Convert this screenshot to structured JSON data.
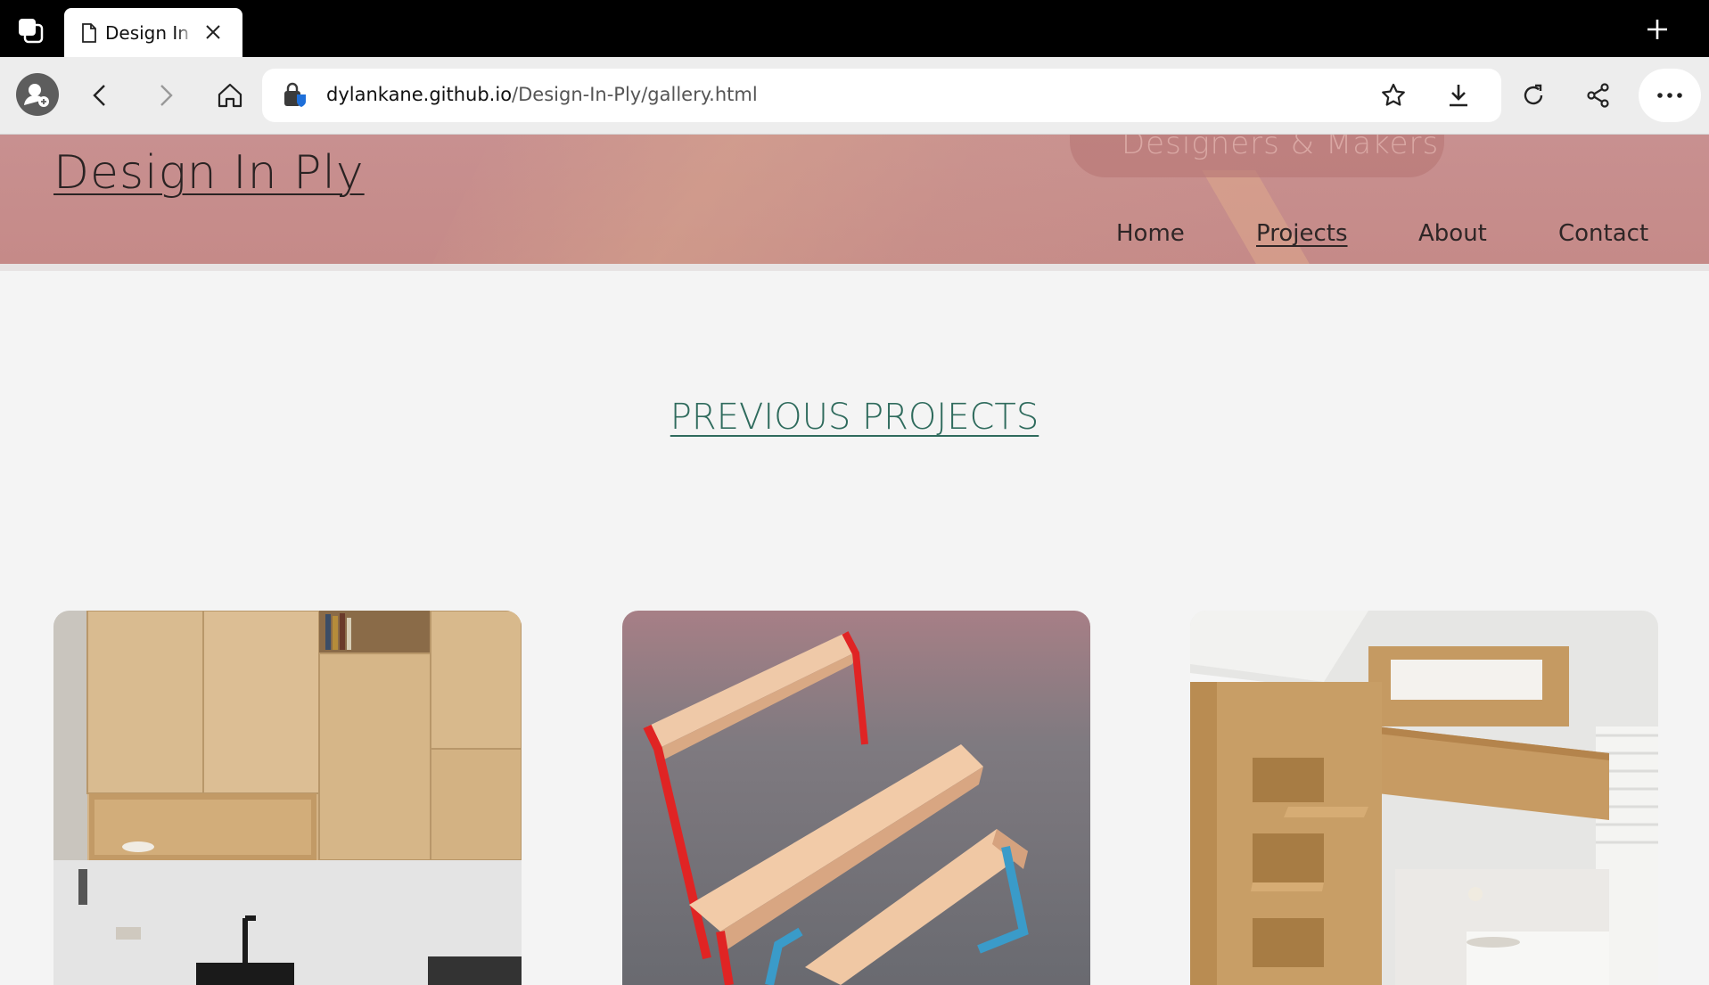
{
  "browser": {
    "tab_title": "Design In Ply",
    "url_host": "dylankane.github.io",
    "url_path": "/Design-In-Ply/gallery.html"
  },
  "site": {
    "title": "Design In Ply",
    "tagline": "Designers & Makers",
    "nav": [
      "Home",
      "Projects",
      "About",
      "Contact"
    ],
    "active_nav": "Projects"
  },
  "main": {
    "heading": "PREVIOUS PROJECTS",
    "projects": [
      {
        "subject": "plywood kitchen cabinets"
      },
      {
        "subject": "plywood bench"
      },
      {
        "subject": "plywood loft bed"
      }
    ]
  },
  "colors": {
    "header": "#c58a88",
    "heading": "#2f6b5d",
    "page_bg": "#f4f4f4"
  }
}
